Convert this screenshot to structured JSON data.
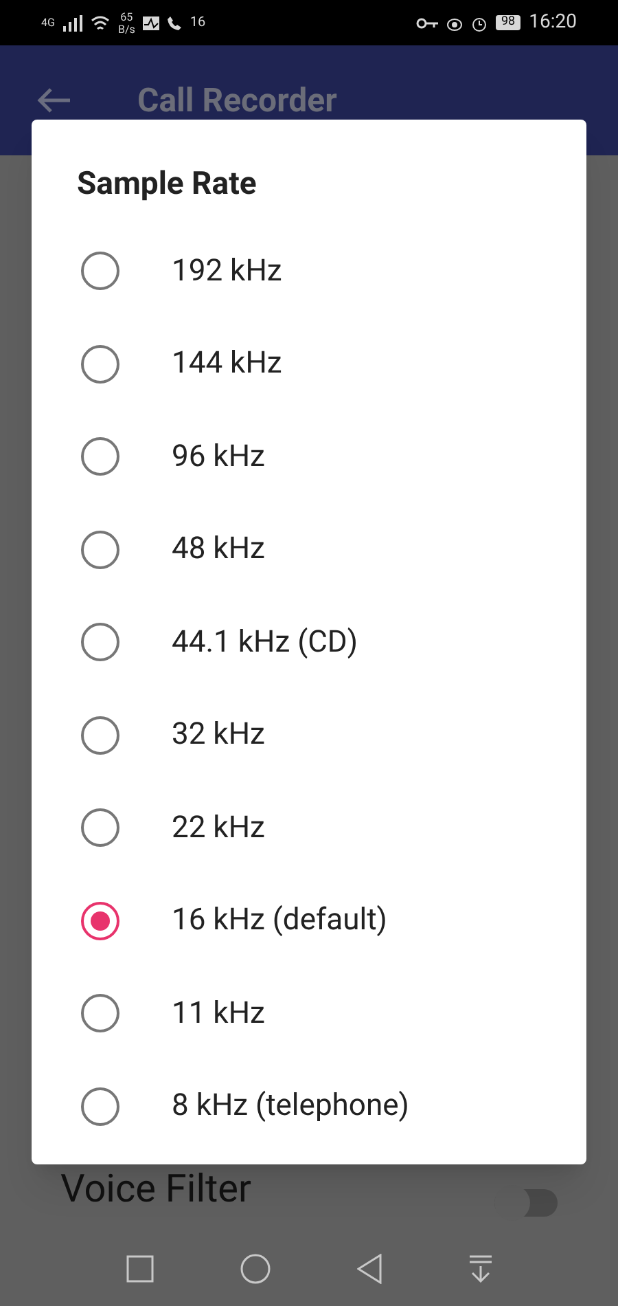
{
  "status_bar": {
    "network": "4G",
    "speed": "65",
    "speed_unit": "B/s",
    "notification_count": "16",
    "battery": "98",
    "time": "16:20"
  },
  "app_bar": {
    "title": "Call Recorder"
  },
  "settings": [
    {
      "label": "Voice Filter",
      "kind": "switch",
      "on": false
    }
  ],
  "dialog": {
    "title": "Sample Rate",
    "options": [
      {
        "label": "192 kHz",
        "selected": false
      },
      {
        "label": "144 kHz",
        "selected": false
      },
      {
        "label": "96 kHz",
        "selected": false
      },
      {
        "label": "48 kHz",
        "selected": false
      },
      {
        "label": "44.1 kHz (CD)",
        "selected": false
      },
      {
        "label": "32 kHz",
        "selected": false
      },
      {
        "label": "22 kHz",
        "selected": false
      },
      {
        "label": "16 kHz (default)",
        "selected": true
      },
      {
        "label": "11 kHz",
        "selected": false
      },
      {
        "label": "8 kHz (telephone)",
        "selected": false
      }
    ]
  }
}
